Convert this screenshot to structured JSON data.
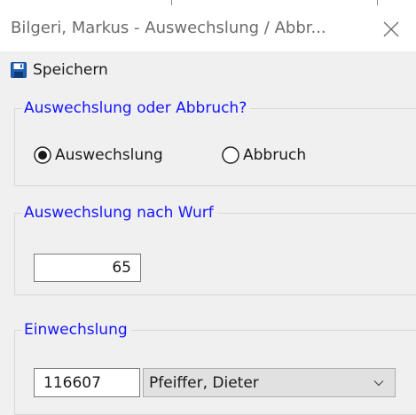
{
  "window": {
    "title": "Bilgeri, Markus - Auswechslung / Abbr...",
    "close_icon": "close-icon"
  },
  "toolbar": {
    "save_label": "Speichern",
    "save_icon": "floppy-disk-icon"
  },
  "group_mode": {
    "legend": "Auswechslung oder Abbruch?",
    "options": [
      {
        "label": "Auswechslung",
        "selected": true
      },
      {
        "label": "Abbruch",
        "selected": false
      }
    ]
  },
  "group_throw": {
    "legend": "Auswechslung nach Wurf",
    "value": "65"
  },
  "group_sub": {
    "legend": "Einwechslung",
    "player_id": "116607",
    "player_name": "Pfeiffer, Dieter"
  },
  "colors": {
    "legend_text": "#1414ff",
    "window_background": "#f0f0f0",
    "title_text": "#6b6b6b",
    "save_icon_blue": "#1f5fb4"
  }
}
